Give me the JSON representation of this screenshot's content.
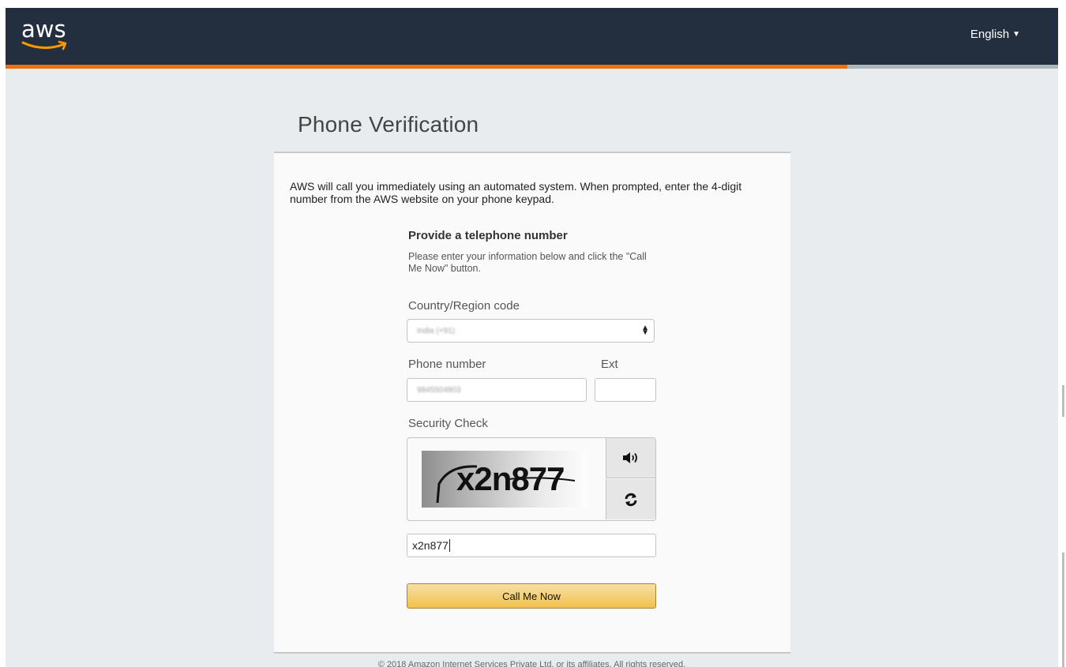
{
  "header": {
    "logo_text": "aws",
    "language": "English",
    "progress_fraction": 0.8,
    "colors": {
      "bar": "#232f3e",
      "accent": "#ec7211"
    }
  },
  "page": {
    "title": "Phone Verification",
    "intro": "AWS will call you immediately using an automated system. When prompted, enter the 4-digit number from the AWS website on your phone keypad."
  },
  "form": {
    "section_title": "Provide a telephone number",
    "section_desc": "Please enter your information below and click the \"Call Me Now\" button.",
    "country_label": "Country/Region code",
    "country_value": "India (+91)",
    "phone_label": "Phone number",
    "phone_value": "9845504803",
    "ext_label": "Ext",
    "ext_value": "",
    "security_label": "Security Check",
    "captcha_text": "x2n877",
    "captcha_input_value": "x2n877",
    "audio_icon": "speaker-icon",
    "refresh_icon": "refresh-icon",
    "submit_label": "Call Me Now"
  },
  "footer": {
    "text": "© 2018 Amazon Internet Services Private Ltd. or its affiliates. All rights reserved."
  }
}
